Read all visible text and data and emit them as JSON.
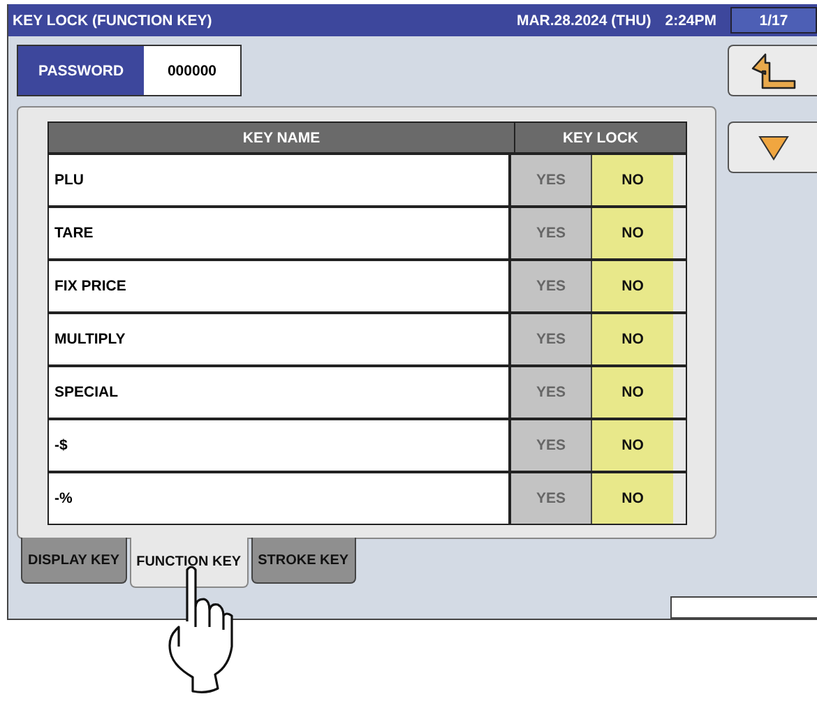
{
  "title": "KEY LOCK (FUNCTION KEY)",
  "date": "MAR.28.2024 (THU)",
  "time": "2:24PM",
  "page": "1/17",
  "password": {
    "label": "PASSWORD",
    "value": "000000"
  },
  "table": {
    "columns": [
      "KEY NAME",
      "KEY LOCK"
    ],
    "rows": [
      {
        "name": "PLU",
        "yes": "YES",
        "no": "NO",
        "locked": false
      },
      {
        "name": "TARE",
        "yes": "YES",
        "no": "NO",
        "locked": false
      },
      {
        "name": "FIX PRICE",
        "yes": "YES",
        "no": "NO",
        "locked": false
      },
      {
        "name": "MULTIPLY",
        "yes": "YES",
        "no": "NO",
        "locked": false
      },
      {
        "name": "SPECIAL",
        "yes": "YES",
        "no": "NO",
        "locked": false
      },
      {
        "name": "-$",
        "yes": "YES",
        "no": "NO",
        "locked": false
      },
      {
        "name": "-%",
        "yes": "YES",
        "no": "NO",
        "locked": false
      }
    ]
  },
  "tabs": [
    {
      "label": "DISPLAY KEY",
      "selected": false
    },
    {
      "label": "FUNCTION KEY",
      "selected": true
    },
    {
      "label": "STROKE KEY",
      "selected": false
    }
  ]
}
